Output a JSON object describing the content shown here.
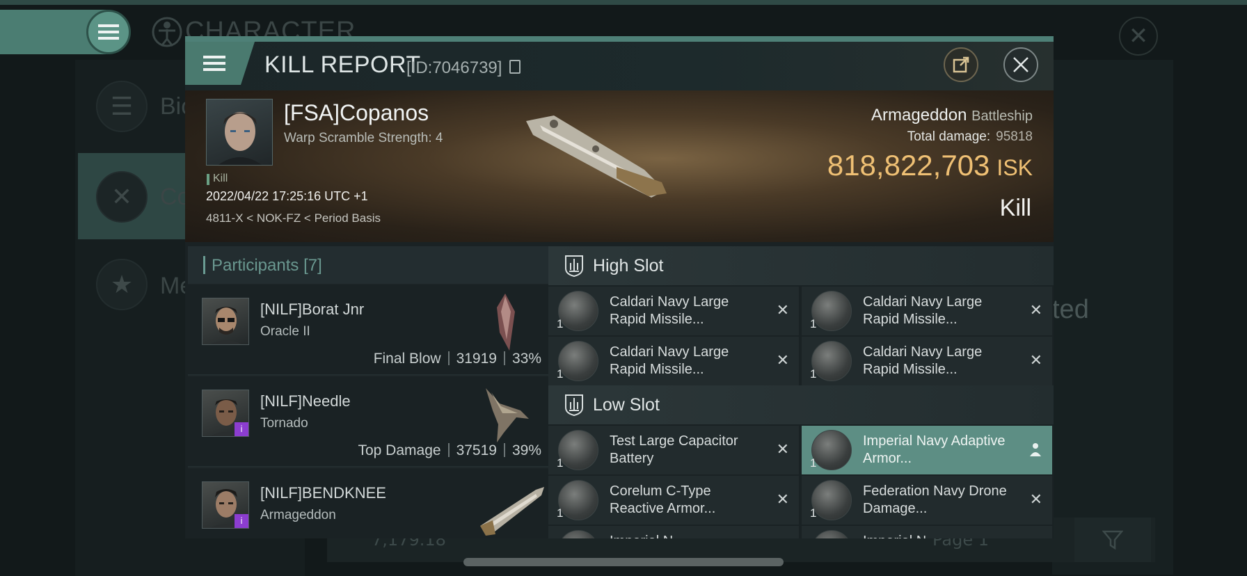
{
  "background": {
    "title": "CHARACTER",
    "side_items": [
      "Bio",
      "Co",
      "Me"
    ],
    "right_text": "ted",
    "bottom_value": "7,179.18",
    "bottom_page": "Page 1"
  },
  "header": {
    "title": "KILL REPORT",
    "id": "[ID:7046739]"
  },
  "victim": {
    "name": "[FSA]Copanos",
    "warp": "Warp Scramble Strength: 4",
    "tag": "Kill",
    "datetime": "2022/04/22 17:25:16 UTC +1",
    "location": "4811-X < NOK-FZ < Period Basis"
  },
  "ship": {
    "name": "Armageddon",
    "class": "Battleship",
    "total_damage_label": "Total damage:",
    "total_damage": "95818",
    "isk_value": "818,822,703",
    "isk_unit": "ISK",
    "result": "Kill"
  },
  "participants": {
    "label": "Participants",
    "count": "[7]",
    "rows": [
      {
        "name": "[NILF]Borat Jnr",
        "ship": "Oracle II",
        "role": "Final Blow",
        "damage": "31919",
        "percent": "33%"
      },
      {
        "name": "[NILF]Needle",
        "ship": "Tornado",
        "role": "Top Damage",
        "damage": "37519",
        "percent": "39%"
      },
      {
        "name": "[NILF]BENDKNEE",
        "ship": "Armageddon",
        "role": "",
        "damage": "",
        "percent": ""
      }
    ]
  },
  "high_slot": {
    "label": "High Slot",
    "items": [
      {
        "name": "Caldari Navy Large Rapid Missile...",
        "qty": "1"
      },
      {
        "name": "Caldari Navy Large Rapid Missile...",
        "qty": "1"
      },
      {
        "name": "Caldari Navy Large Rapid Missile...",
        "qty": "1"
      },
      {
        "name": "Caldari Navy Large Rapid Missile...",
        "qty": "1"
      }
    ]
  },
  "low_slot": {
    "label": "Low Slot",
    "items": [
      {
        "name": "Test Large Capacitor Battery",
        "qty": "1"
      },
      {
        "name": "Imperial Navy Adaptive Armor...",
        "qty": "1"
      },
      {
        "name": "Corelum C-Type Reactive Armor...",
        "qty": "1"
      },
      {
        "name": "Federation Navy Drone Damage...",
        "qty": "1"
      },
      {
        "name": "Imperial N...",
        "qty": ""
      },
      {
        "name": "Imperial N...",
        "qty": ""
      }
    ]
  },
  "colors": {
    "accent": "#4e8077",
    "isk": "#efc074",
    "highlight": "#5d8e84",
    "badge": "#8c3dd0"
  }
}
